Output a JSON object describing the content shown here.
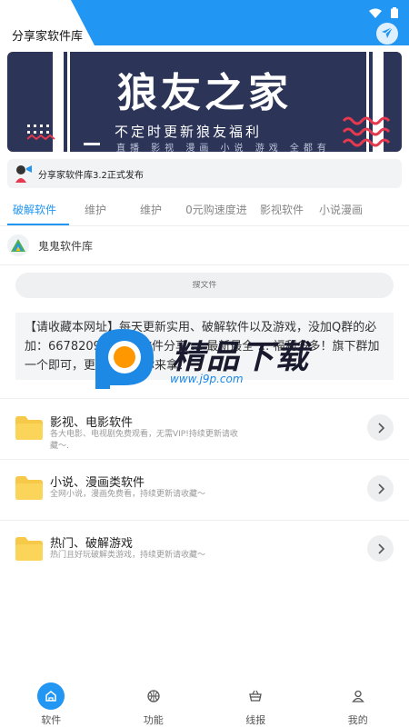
{
  "app": {
    "title": "分享家软件库"
  },
  "colors": {
    "accent": "#2196f3",
    "banner_bg": "#2c3458",
    "wave_red": "#e53950",
    "folder": "#f7c948"
  },
  "banner": {
    "title": "狼友之家",
    "subtitle": "不定时更新狼友福利",
    "tagline": "直播 影视 漫画 小说 游戏 全都有"
  },
  "notice": {
    "text": "分享家软件库3.2正式发布",
    "icon": "megaphone-avatar-icon"
  },
  "tabs": [
    {
      "label": "破解软件",
      "active": true
    },
    {
      "label": "维护",
      "active": false
    },
    {
      "label": "维护",
      "active": false
    },
    {
      "label": "0元购速度进",
      "active": false
    },
    {
      "label": "影视软件",
      "active": false
    },
    {
      "label": "小说漫画",
      "active": false
    }
  ],
  "source": {
    "name": "鬼鬼软件库",
    "logo": "triangle-logo-icon"
  },
  "search": {
    "placeholder": "搜文件"
  },
  "announcement": {
    "text": "【请收藏本网址】每天更新实用、破解软件以及游戏，没加Q群的必加：6678209… 更多软件分享 … 最新最全 … 福利多多！旗下群加一个即可，更多福利等你来拿！"
  },
  "watermark": {
    "text": "精品下载",
    "url": "www.j9p.com"
  },
  "categories": [
    {
      "title": "影视、电影软件",
      "desc": "各大电影、电视剧免费观看，无需VIP!持续更新请收藏〜.",
      "icon": "folder-icon"
    },
    {
      "title": "小说、漫画类软件",
      "desc": "全网小说，漫画免费看，持续更新请收藏〜",
      "icon": "folder-icon"
    },
    {
      "title": "热门、破解游戏",
      "desc": "热门且好玩破解类游戏，持续更新请收藏〜",
      "icon": "folder-icon"
    }
  ],
  "nav": [
    {
      "label": "软件",
      "icon": "home-icon",
      "active": true
    },
    {
      "label": "功能",
      "icon": "basketball-icon",
      "active": false
    },
    {
      "label": "线报",
      "icon": "basket-icon",
      "active": false
    },
    {
      "label": "我的",
      "icon": "user-icon",
      "active": false
    }
  ]
}
